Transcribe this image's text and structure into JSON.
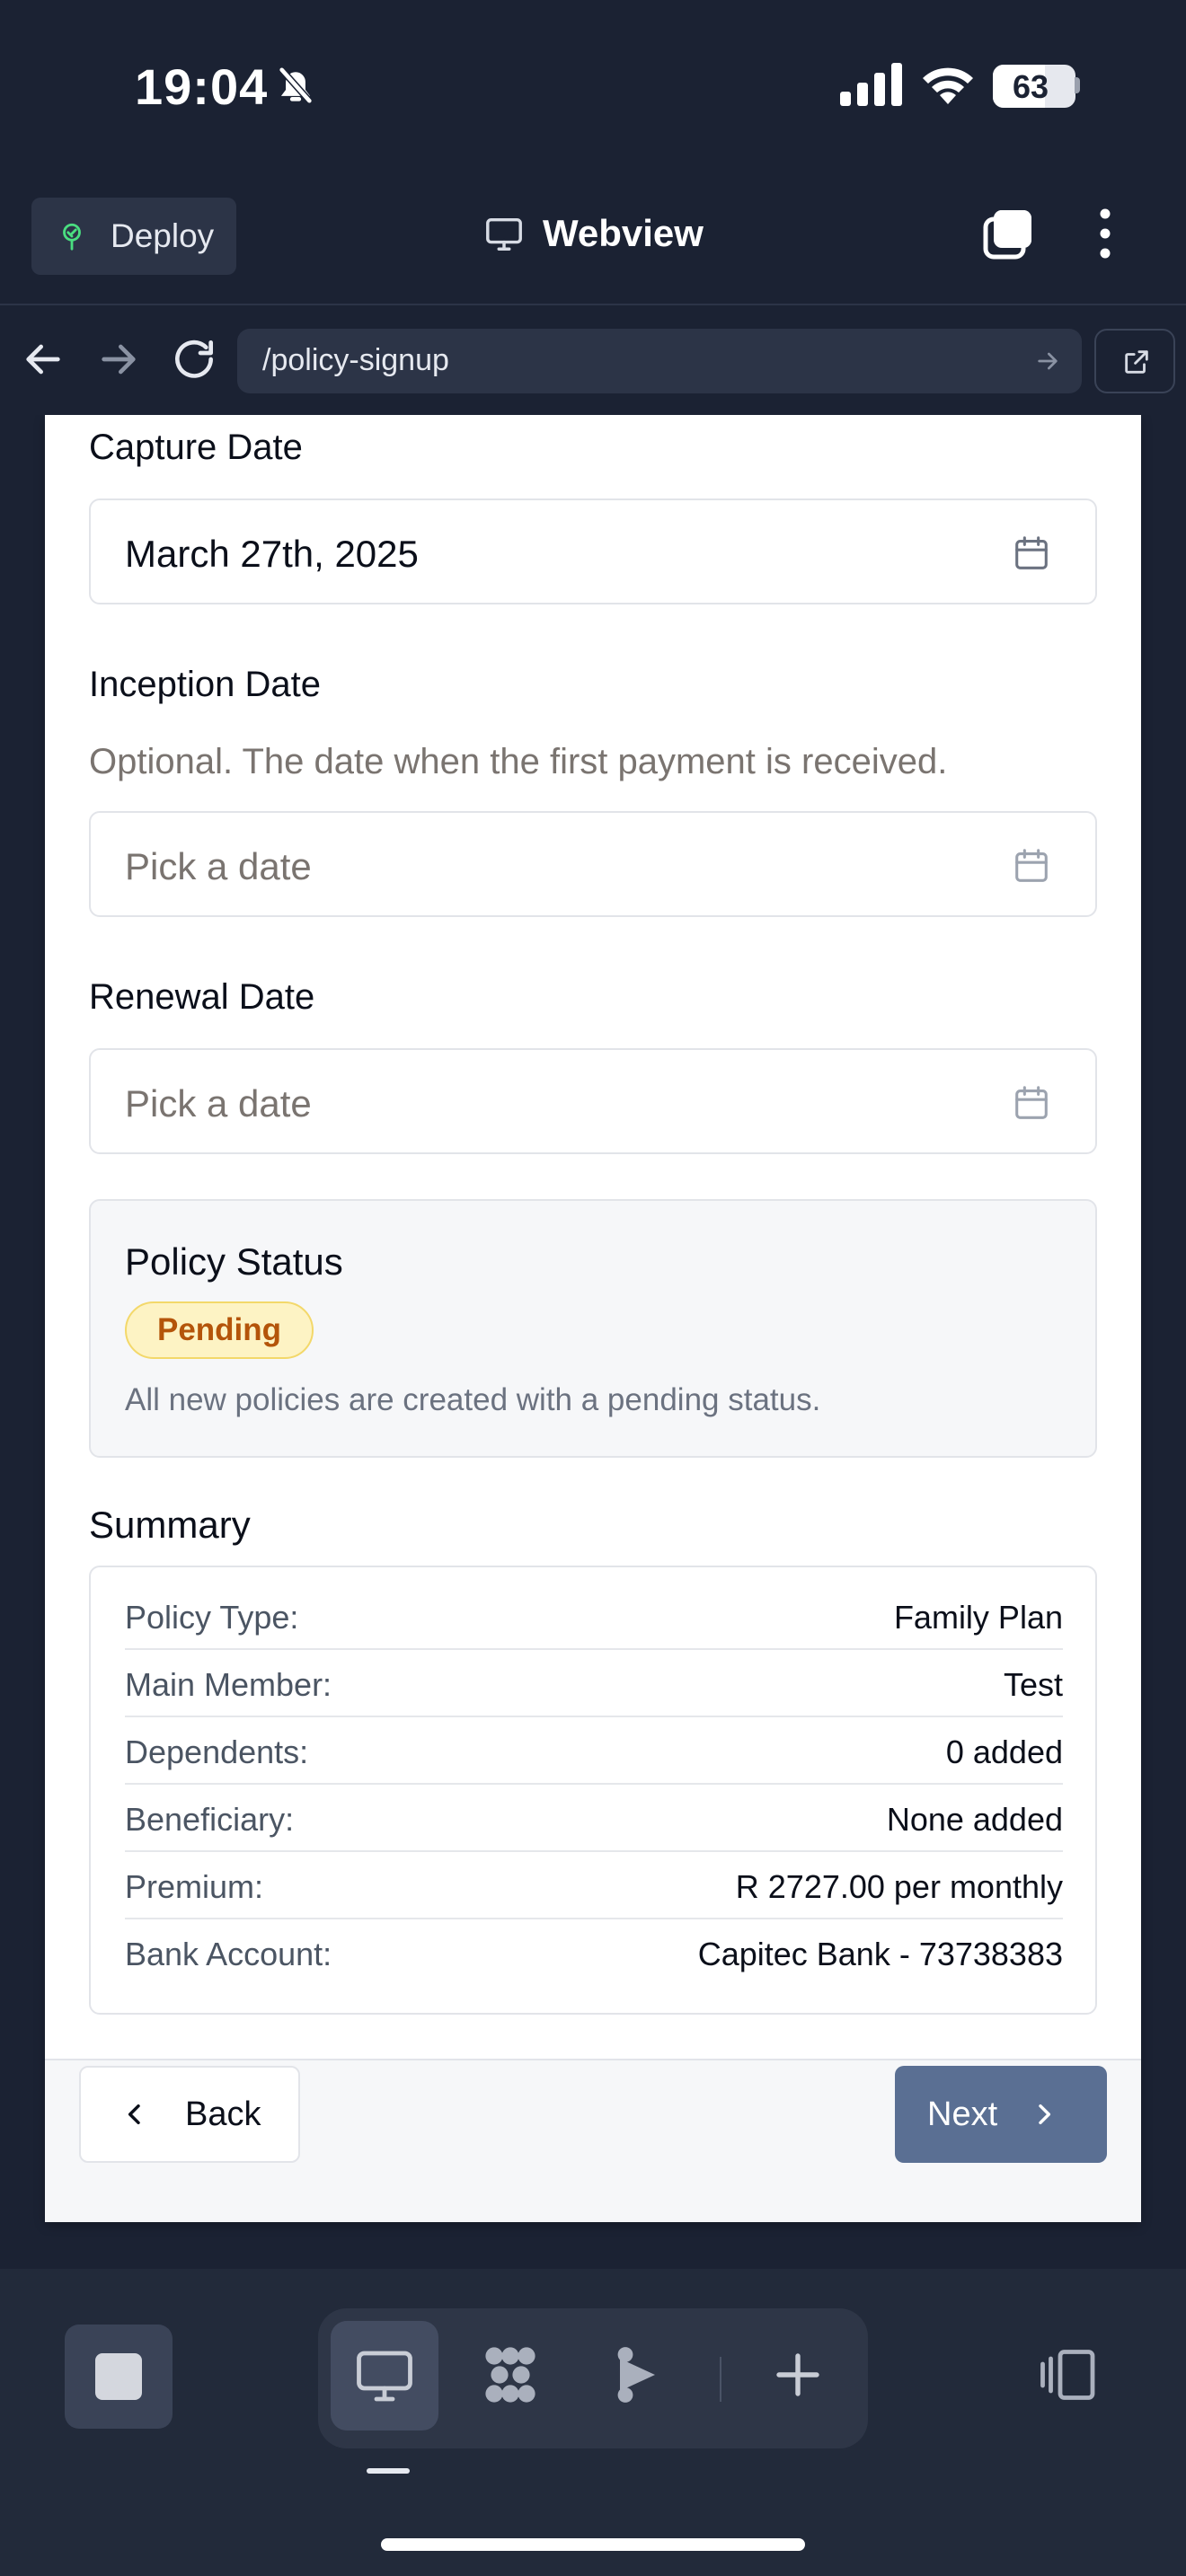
{
  "status_bar": {
    "time": "19:04",
    "battery_percent": "63",
    "battery_level": 0.63
  },
  "toolbar": {
    "deploy_label": "Deploy",
    "title": "Webview"
  },
  "address_bar": {
    "url": "/policy-signup"
  },
  "form": {
    "capture_date": {
      "label": "Capture Date",
      "value": "March 27th, 2025"
    },
    "inception_date": {
      "label": "Inception Date",
      "hint": "Optional. The date when the first payment is received.",
      "placeholder": "Pick a date"
    },
    "renewal_date": {
      "label": "Renewal Date",
      "placeholder": "Pick a date"
    },
    "policy_status": {
      "title": "Policy Status",
      "badge": "Pending",
      "note": "All new policies are created with a pending status.",
      "badge_colors": {
        "background": "#fdf3c4",
        "border": "#f3d86a",
        "text": "#b4540a"
      }
    },
    "summary": {
      "title": "Summary",
      "rows": [
        {
          "key": "Policy Type:",
          "value": "Family Plan"
        },
        {
          "key": "Main Member:",
          "value": "Test"
        },
        {
          "key": "Dependents:",
          "value": "0 added"
        },
        {
          "key": "Beneficiary:",
          "value": "None added"
        },
        {
          "key": "Premium:",
          "value": "R 2727.00 per monthly"
        },
        {
          "key": "Bank Account:",
          "value": "Capitec Bank - 73738383"
        }
      ]
    },
    "buttons": {
      "back": "Back",
      "next": "Next"
    }
  },
  "colors": {
    "chrome_bg": "#1b2233",
    "next_button": "#5a6f93",
    "deploy_icon": "#4ade80"
  },
  "icons": {
    "status": [
      "bell-off-icon",
      "signal-icon",
      "wifi-icon",
      "battery-icon"
    ],
    "toolbar": [
      "plant-icon",
      "monitor-icon",
      "tabs-icon",
      "more-vertical-icon"
    ],
    "address": [
      "arrow-left-icon",
      "arrow-right-icon",
      "reload-icon",
      "go-arrow-icon",
      "external-link-icon"
    ],
    "form": [
      "calendar-icon",
      "chevron-left-icon",
      "chevron-right-icon"
    ],
    "dock": [
      "stop-icon",
      "monitor-icon",
      "dots-grid-icon",
      "play-branch-icon",
      "plus-icon",
      "split-view-icon"
    ]
  }
}
